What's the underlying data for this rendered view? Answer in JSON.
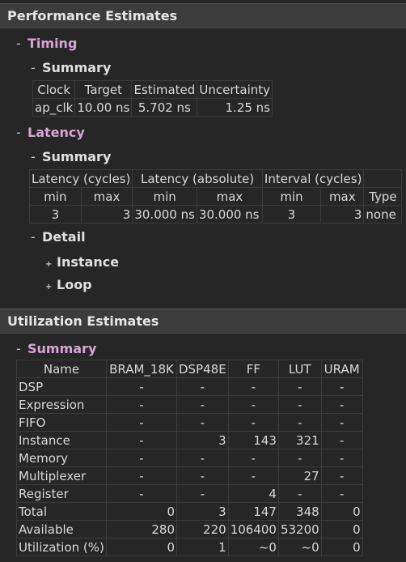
{
  "performance": {
    "header": "Performance Estimates",
    "timing": {
      "label": "Timing",
      "summary_label": "Summary",
      "columns": [
        "Clock",
        "Target",
        "Estimated",
        "Uncertainty"
      ],
      "row": [
        "ap_clk",
        "10.00 ns",
        "5.702 ns",
        "1.25 ns"
      ]
    },
    "latency": {
      "label": "Latency",
      "summary_label": "Summary",
      "groups": [
        "Latency (cycles)",
        "Latency (absolute)",
        "Interval (cycles)"
      ],
      "columns": [
        "min",
        "max",
        "min",
        "max",
        "min",
        "max",
        "Type"
      ],
      "row": [
        "3",
        "3",
        "30.000 ns",
        "30.000 ns",
        "3",
        "3",
        "none"
      ],
      "detail_label": "Detail",
      "instance_label": "Instance",
      "loop_label": "Loop"
    }
  },
  "utilization": {
    "header": "Utilization Estimates",
    "summary_label": "Summary",
    "columns": [
      "Name",
      "BRAM_18K",
      "DSP48E",
      "FF",
      "LUT",
      "URAM"
    ],
    "rows": [
      [
        "DSP",
        "-",
        "-",
        "-",
        "-",
        "-"
      ],
      [
        "Expression",
        "-",
        "-",
        "-",
        "-",
        "-"
      ],
      [
        "FIFO",
        "-",
        "-",
        "-",
        "-",
        "-"
      ],
      [
        "Instance",
        "-",
        "3",
        "143",
        "321",
        "-"
      ],
      [
        "Memory",
        "-",
        "-",
        "-",
        "-",
        "-"
      ],
      [
        "Multiplexer",
        "-",
        "-",
        "-",
        "27",
        "-"
      ],
      [
        "Register",
        "-",
        "-",
        "4",
        "-",
        "-"
      ],
      [
        "Total",
        "0",
        "3",
        "147",
        "348",
        "0"
      ],
      [
        "Available",
        "280",
        "220",
        "106400",
        "53200",
        "0"
      ],
      [
        "Utilization (%)",
        "0",
        "1",
        "~0",
        "~0",
        "0"
      ]
    ]
  },
  "icons": {
    "expanded": "-",
    "collapsed": "+"
  },
  "colors": {
    "background": "#262626",
    "header_bg": "#3c3c3c",
    "section": "#d7a4d7",
    "grid": "#3b3b3b"
  }
}
